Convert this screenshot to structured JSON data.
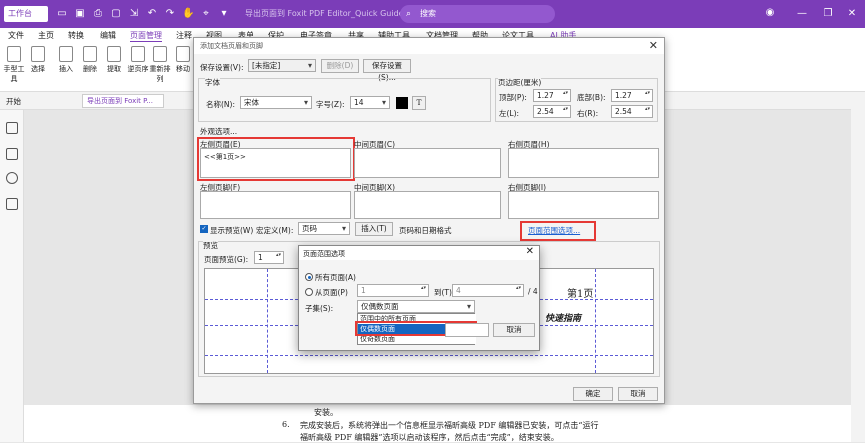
{
  "titlebar": {
    "app_button": "工作台",
    "doc_title": "导出页面到 Foxit PDF Editor_Quick Guide.pdf *",
    "search_placeholder": "搜索"
  },
  "menu": [
    "文件",
    "主页",
    "转换",
    "编辑",
    "页面管理",
    "注释",
    "视图",
    "表单",
    "保护",
    "电子签章",
    "共享",
    "辅助工具",
    "文档管理",
    "帮助",
    "论文工具",
    "AI 助手"
  ],
  "ribbon": {
    "buttons": [
      "手型工具",
      "选择",
      "插入",
      "删除",
      "提取",
      "逆页序",
      "重新排列",
      "移动"
    ]
  },
  "tabs": {
    "start": "开始",
    "doc_tab": "导出页面到 Foxit P..."
  },
  "dialog": {
    "title": "添加文档页眉和页脚",
    "saved_settings_label": "保存设置(V):",
    "saved_settings_value": "[未指定]",
    "delete_btn": "删除(D)",
    "save_settings_btn": "保存设置(S)...",
    "font_group": "字体",
    "name_label": "名称(N):",
    "name_value": "宋体",
    "size_label": "字号(Z):",
    "size_value": "14",
    "text_icon": "T",
    "margin_group": "页边距(厘米)",
    "top_label": "顶部(P):",
    "top_value": "1.27",
    "bottom_label": "底部(B):",
    "bottom_value": "1.27",
    "left_label": "左(L):",
    "left_value": "2.54",
    "right_label": "右(R):",
    "right_value": "2.54",
    "appearance_label": "外观选项...",
    "left_header_label": "左侧页眉(E)",
    "left_header_text": "<<第1页>>",
    "center_header_label": "中间页眉(C)",
    "right_header_label": "右侧页眉(H)",
    "left_footer_label": "左侧页脚(F)",
    "center_footer_label": "中间页脚(X)",
    "right_footer_label": "右侧页脚(I)",
    "show_preview": "显示预览(W)",
    "macro_label": "宏定义(M):",
    "macro_value": "页码",
    "insert_btn": "插入(T)",
    "page_date_format": "页码和日期格式",
    "page_range_link": "页面范围选项...",
    "preview_group": "预览",
    "preview_page_label": "页面预览(G):",
    "preview_page_value": "1",
    "preview_header_text": "第1页",
    "preview_body_text": "快速指南",
    "ok_btn": "确定",
    "cancel_btn": "取消"
  },
  "subdialog": {
    "title": "页面范围选项",
    "all_pages": "所有页面(A)",
    "from_page": "从页面(P)",
    "from_value": "1",
    "to_label": "到(T)",
    "to_value": "4",
    "total": "/ 4",
    "subset_label": "子集(S):",
    "subset_value": "仅偶数页面",
    "options": [
      "范围中的所有页面",
      "仅偶数页面",
      "仅奇数页面"
    ],
    "cancel_btn": "取消"
  },
  "document": {
    "line1": "安装。",
    "line2_num": "6.",
    "line2": "完成安装后，系统将弹出一个信息框显示福昕高级 PDF 编辑器已安装，可点击“运行",
    "line3": "福昕高级 PDF 编辑器”选项以启动该程序，然后点击“完成”，结束安装。"
  },
  "colors": {
    "brand": "#7b3db8",
    "highlight": "#e53935",
    "selection": "#1565c0",
    "link": "#1a5fd1"
  }
}
